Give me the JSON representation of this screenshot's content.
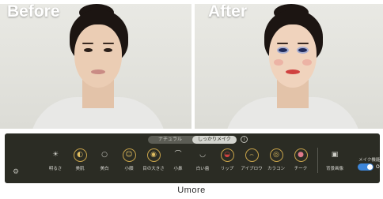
{
  "photos": {
    "before_label": "Before",
    "after_label": "After"
  },
  "mode_switch": {
    "options": [
      "ナチュラル",
      "しっかりメイク"
    ],
    "selected": "しっかりメイク"
  },
  "tools": [
    {
      "label": "明るさ",
      "icon": "sun-icon",
      "selected": false
    },
    {
      "label": "美肌",
      "icon": "skin-icon",
      "selected": true
    },
    {
      "label": "美白",
      "icon": "face-icon",
      "selected": false
    },
    {
      "label": "小顔",
      "icon": "face-slim-icon",
      "selected": true
    },
    {
      "label": "目の大きさ",
      "icon": "eye-icon",
      "selected": true
    },
    {
      "label": "小鼻",
      "icon": "nose-icon",
      "selected": false
    },
    {
      "label": "白い歯",
      "icon": "teeth-icon",
      "selected": false
    },
    {
      "label": "リップ",
      "icon": "lip-icon",
      "selected": true
    },
    {
      "label": "アイブロウ",
      "icon": "eyebrow-icon",
      "selected": true
    },
    {
      "label": "カラコン",
      "icon": "color-contact-icon",
      "selected": true
    },
    {
      "label": "チーク",
      "icon": "cheek-icon",
      "selected": true
    }
  ],
  "background_tool": {
    "label": "背景画像",
    "icon": "image-icon"
  },
  "makeup_function": {
    "label": "メイク機能",
    "state": "ON"
  },
  "caption": "Umore",
  "colors": {
    "toolbar_bg": "#2b2c24",
    "accent_ring": "#c8a34a",
    "toggle_on": "#3d86d9",
    "lip_red": "#d0413f"
  }
}
